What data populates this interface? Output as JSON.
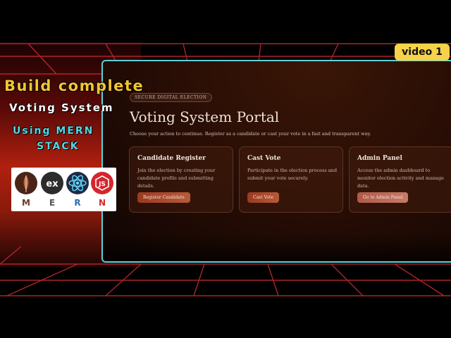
{
  "video_badge": "video 1",
  "headline": {
    "line1": "Build complete",
    "line2": "Voting System",
    "line3": "Using MERN",
    "line4": "STACK"
  },
  "logos": {
    "letters": [
      "M",
      "E",
      "R",
      "N"
    ],
    "icons": [
      "mongodb-icon",
      "express-icon",
      "react-icon",
      "nodejs-icon"
    ]
  },
  "portal": {
    "badge": "SECURE DIGITAL ELECTION",
    "title": "Voting System Portal",
    "subtitle": "Choose your action to continue. Register as a candidate or cast your vote in a fast and transparent way.",
    "cards": [
      {
        "title": "Candidate Register",
        "description": "Join the election by creating your candidate profile and submitting details.",
        "button": "Register Candidate"
      },
      {
        "title": "Cast Vote",
        "description": "Participate in the election process and submit your vote securely.",
        "button": "Cast Vote"
      },
      {
        "title": "Admin Panel",
        "description": "Access the admin dashboard to monitor election activity and manage data.",
        "button": "Go to Admin Panel"
      }
    ]
  },
  "colors": {
    "accent_yellow": "#f4c430",
    "accent_cyan": "#56d8e4",
    "portal_border": "#5fd0d6",
    "button": "#a84428"
  }
}
